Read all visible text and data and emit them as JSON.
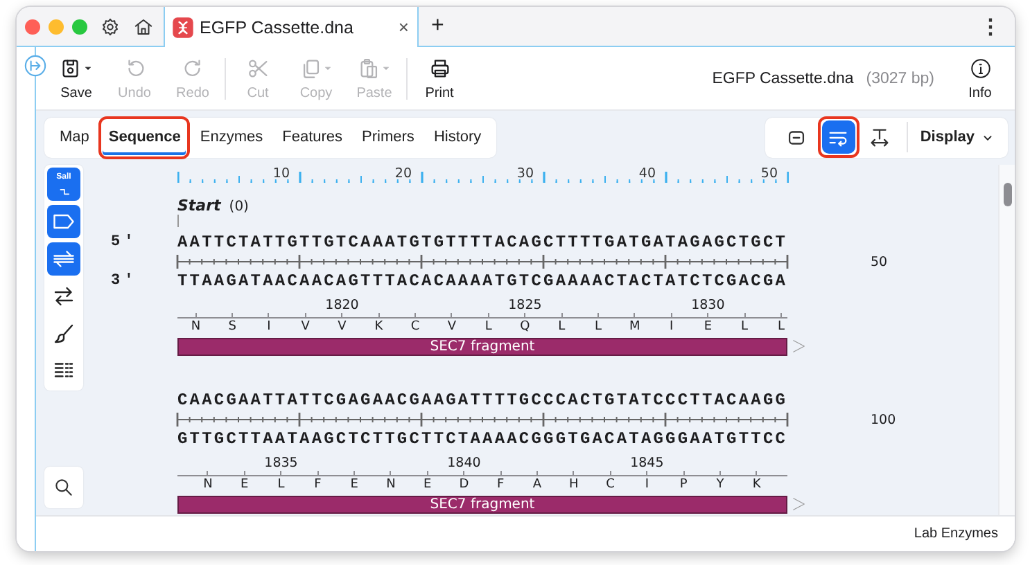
{
  "titlebar": {
    "tab": {
      "title": "EGFP Cassette.dna",
      "close": "×"
    },
    "new_tab": "+",
    "more": "⋮"
  },
  "toolbar": {
    "groups": [
      [
        {
          "label": "Save",
          "kind": "save",
          "disabled": false,
          "dropdown": true
        },
        {
          "label": "Undo",
          "kind": "undo",
          "disabled": true,
          "dropdown": false
        },
        {
          "label": "Redo",
          "kind": "redo",
          "disabled": true,
          "dropdown": false
        }
      ],
      [
        {
          "label": "Cut",
          "kind": "cut",
          "disabled": true,
          "dropdown": false
        },
        {
          "label": "Copy",
          "kind": "copy",
          "disabled": true,
          "dropdown": true
        },
        {
          "label": "Paste",
          "kind": "paste",
          "disabled": true,
          "dropdown": true
        }
      ],
      [
        {
          "label": "Print",
          "kind": "print",
          "disabled": false,
          "dropdown": false
        }
      ]
    ],
    "document": {
      "name": "EGFP Cassette.dna",
      "length": "(3027 bp)"
    },
    "info": {
      "label": "Info"
    }
  },
  "view_tabs": [
    {
      "label": "Map",
      "selected": false,
      "highlighted": false
    },
    {
      "label": "Sequence",
      "selected": true,
      "highlighted": true
    },
    {
      "label": "Enzymes",
      "selected": false,
      "highlighted": false
    },
    {
      "label": "Features",
      "selected": false,
      "highlighted": false
    },
    {
      "label": "Primers",
      "selected": false,
      "highlighted": false
    },
    {
      "label": "History",
      "selected": false,
      "highlighted": false
    }
  ],
  "view_buttons": [
    {
      "kind": "fit",
      "selected": false,
      "highlighted": false
    },
    {
      "kind": "wrap",
      "selected": true,
      "highlighted": true
    },
    {
      "kind": "width",
      "selected": false,
      "highlighted": false
    }
  ],
  "display_menu": {
    "label": "Display"
  },
  "side_tools": [
    {
      "kind": "enzyme",
      "label": "SalI",
      "on": true
    },
    {
      "kind": "feature",
      "on": true
    },
    {
      "kind": "strands",
      "on": true
    },
    {
      "kind": "arrows",
      "on": false
    },
    {
      "kind": "brush",
      "on": false
    },
    {
      "kind": "list",
      "on": false
    }
  ],
  "ruler": {
    "ticks": [
      "10",
      "20",
      "30",
      "40",
      "50"
    ]
  },
  "start_marker": {
    "label": "Start",
    "position": "(0)"
  },
  "sequence_rows": [
    {
      "top_label": "5'",
      "bottom_label": "3'",
      "top": "AATTCTATTGTTGTCAAATGTGTTTTACAGCTTTTGATGATAGAGCTGCT",
      "bottom": "TTAAGATAACAACAGTTTACACAAAATGTCGAAAACTACTATCTCGACGA",
      "end_number": "50",
      "amino_acids": [
        {
          "code": "N"
        },
        {
          "code": "S"
        },
        {
          "code": "I"
        },
        {
          "code": "V"
        },
        {
          "code": "V",
          "number": "1820"
        },
        {
          "code": "K"
        },
        {
          "code": "C"
        },
        {
          "code": "V"
        },
        {
          "code": "L"
        },
        {
          "code": "Q",
          "number": "1825"
        },
        {
          "code": "L"
        },
        {
          "code": "L"
        },
        {
          "code": "M"
        },
        {
          "code": "I"
        },
        {
          "code": "E",
          "number": "1830"
        },
        {
          "code": "L"
        },
        {
          "code": "L"
        }
      ],
      "feature": {
        "label": "SEC7 fragment",
        "color": "#9b2b6a"
      }
    },
    {
      "top": "CAACGAATTATTCGAGAACGAAGATTTTGCCCACTGTATCCCTTACAAGG",
      "bottom": "GTTGCTTAATAAGCTCTTGCTTCTAAAACGGGTGACATAGGGAATGTTCC",
      "end_number": "100",
      "amino_acids": [
        {
          "code": "N"
        },
        {
          "code": "E"
        },
        {
          "code": "L",
          "number": "1835"
        },
        {
          "code": "F"
        },
        {
          "code": "E"
        },
        {
          "code": "N"
        },
        {
          "code": "E"
        },
        {
          "code": "D",
          "number": "1840"
        },
        {
          "code": "F"
        },
        {
          "code": "A"
        },
        {
          "code": "H"
        },
        {
          "code": "C"
        },
        {
          "code": "I",
          "number": "1845"
        },
        {
          "code": "P"
        },
        {
          "code": "Y"
        },
        {
          "code": "K"
        }
      ],
      "feature": {
        "label": "SEC7 fragment",
        "color": "#9b2b6a"
      }
    }
  ],
  "status_bar": {
    "text": "Lab Enzymes"
  }
}
